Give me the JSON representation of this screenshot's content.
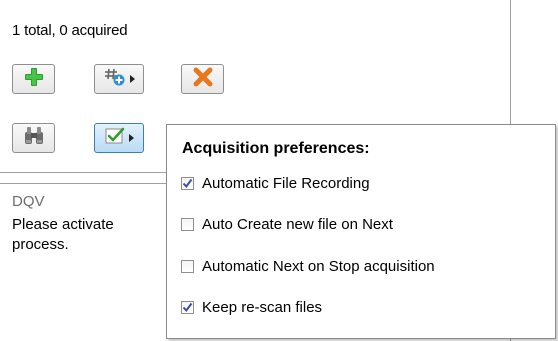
{
  "status_text": "1 total, 0 acquired",
  "toolbar": {
    "row1": [
      {
        "icon": "add-icon",
        "color": "#2e9c2e"
      },
      {
        "icon": "hash-add-icon",
        "has_dropdown": true
      },
      {
        "icon": "delete-icon",
        "color": "#e8781e"
      }
    ],
    "row2": [
      {
        "icon": "binoculars-icon"
      },
      {
        "icon": "checklist-icon",
        "has_dropdown": true,
        "active": true
      }
    ]
  },
  "dqv": {
    "title": "DQV",
    "message_line1": "Please activate",
    "message_line2": "process."
  },
  "popup": {
    "title": "Acquisition preferences:",
    "options": [
      {
        "label": "Automatic File Recording",
        "checked": true
      },
      {
        "label": "Auto Create new file on Next",
        "checked": false
      },
      {
        "label": "Automatic Next on Stop acquisition",
        "checked": false
      },
      {
        "label": "Keep re-scan files",
        "checked": true
      }
    ]
  },
  "colors": {
    "checkmark": "#3a4fa8",
    "active_button": "#b9dcf4"
  }
}
